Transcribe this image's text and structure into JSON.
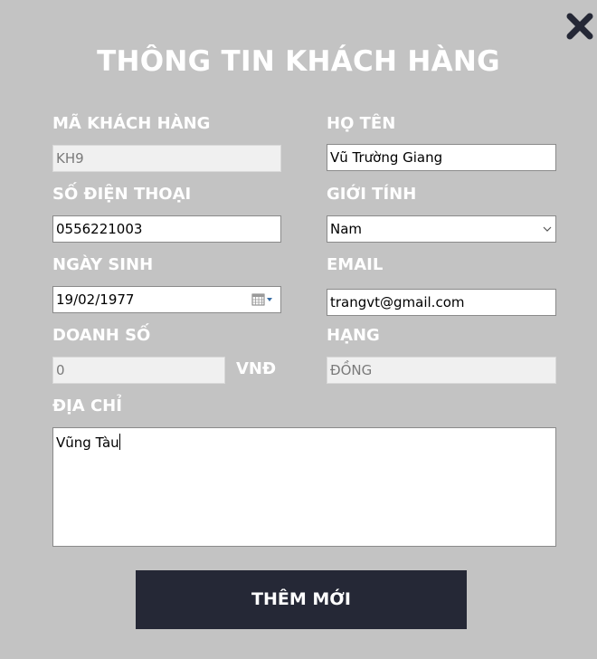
{
  "window": {
    "title": "THÔNG TIN KHÁCH HÀNG"
  },
  "icons": {
    "close": "close-icon",
    "select_arrow": "chevron-down-icon",
    "calendar": "calendar-icon"
  },
  "form": {
    "customer_id": {
      "label": "MÃ KHÁCH HÀNG",
      "value": "KH9"
    },
    "full_name": {
      "label": "HỌ TÊN",
      "value": "Vũ Trường Giang"
    },
    "phone": {
      "label": "SỐ ĐIỆN THOẠI",
      "value": "0556221003"
    },
    "gender": {
      "label": "GIỚI TÍNH",
      "value": "Nam"
    },
    "birth_date": {
      "label": "NGÀY SINH",
      "value": "19/02/1977"
    },
    "email": {
      "label": "EMAIL",
      "value": "trangvt@gmail.com"
    },
    "revenue": {
      "label": "DOANH SỐ",
      "value": "0",
      "unit": "VNĐ"
    },
    "rank": {
      "label": "HẠNG",
      "value": "ĐỒNG"
    },
    "address": {
      "label": "ĐỊA CHỈ",
      "value": "Vũng Tàu"
    }
  },
  "actions": {
    "submit_label": "THÊM MỚI"
  },
  "colors": {
    "background": "#c3c3c3",
    "button": "#252836",
    "text_light": "#ffffff"
  }
}
